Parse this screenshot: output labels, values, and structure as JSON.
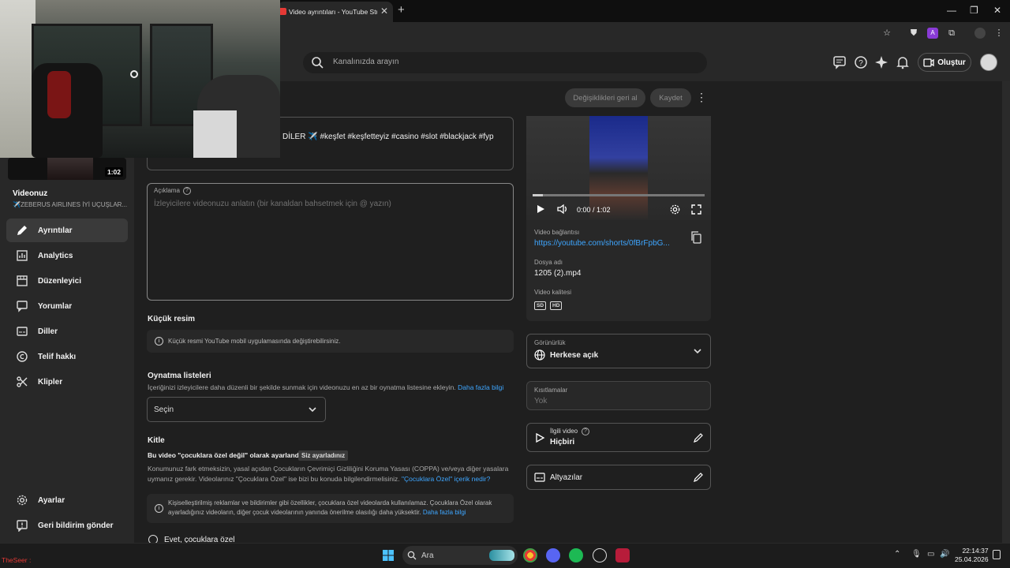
{
  "browser": {
    "tab_title": "Video ayrıntıları - YouTube Studio",
    "new_tab_icon": "plus-icon"
  },
  "topbar": {
    "search_placeholder": "Kanalınızda arayın",
    "create_label": "Oluştur"
  },
  "sidebar": {
    "thumb_duration": "1:02",
    "video_heading": "Videonuz",
    "video_subtitle": "✈️ZEBERUS AIRLINES İYİ UÇUŞLAR...",
    "items": [
      {
        "label": "Ayrıntılar",
        "icon": "pencil-icon",
        "active": true
      },
      {
        "label": "Analytics",
        "icon": "bar-chart-icon"
      },
      {
        "label": "Düzenleyici",
        "icon": "film-editor-icon"
      },
      {
        "label": "Yorumlar",
        "icon": "comment-icon"
      },
      {
        "label": "Diller",
        "icon": "subtitles-icon"
      },
      {
        "label": "Telif hakkı",
        "icon": "copyright-icon"
      },
      {
        "label": "Klipler",
        "icon": "scissors-icon"
      }
    ],
    "bottom_items": [
      {
        "label": "Ayarlar",
        "icon": "gear-icon"
      },
      {
        "label": "Geri bildirim gönder",
        "icon": "feedback-icon"
      }
    ]
  },
  "actions": {
    "revert_label": "Değişiklikleri geri al",
    "save_label": "Kaydet"
  },
  "form": {
    "title_value": "DİLER ✈️ #keşfet #keşfetteyiz #casino #slot #blackjack #fyp",
    "description_label": "Açıklama",
    "description_placeholder": "İzleyicilere videonuzu anlatın (bir kanaldan bahsetmek için @ yazın)",
    "thumbnail_title": "Küçük resim",
    "thumbnail_info": "Küçük resmi YouTube mobil uygulamasında değiştirebilirsiniz.",
    "playlists_title": "Oynatma listeleri",
    "playlists_desc": "İçeriğinizi izleyicilere daha düzenli bir şekilde sunmak için videonuzu en az bir oynatma listesine ekleyin.",
    "playlists_link": "Daha fazla bilgi",
    "playlist_select_value": "Seçin",
    "audience_title": "Kitle",
    "audience_status": "Bu video \"çocuklara özel değil\" olarak ayarlandı",
    "audience_badge": "Siz ayarladınız",
    "audience_desc_1": "Konumunuz fark etmeksizin, yasal açıdan Çocukların Çevrimiçi Gizliliğini Koruma Yasası (COPPA) ve/veya diğer yasalara",
    "audience_desc_2": "uymanız gerekir. Videolarınız \"Çocuklara Özel\" ise bizi bu konuda bilgilendirmelisiniz.",
    "audience_link": "\"Çocuklara Özel\" içerik nedir?",
    "audience_info_1": "Kişiselleştirilmiş reklamlar ve bildirimler gibi özellikler, çocuklara özel videolarda kullanılamaz. Çocuklara Özel olarak",
    "audience_info_2": "ayarladığınız videoların, diğer çocuk videolarının yanında önerilme olasılığı daha yüksektir.",
    "audience_info_link": "Daha fazla bilgi",
    "radio_yes_label": "Evet, çocuklara özel"
  },
  "video_panel": {
    "time": "0:00 / 1:02",
    "progress_fraction": 0.06,
    "link_label": "Video bağlantısı",
    "link_value": "https://youtube.com/shorts/0fBrFpbG...",
    "file_label": "Dosya adı",
    "file_value": "1205 (2).mp4",
    "quality_label": "Video kalitesi",
    "quality_badges": [
      "SD",
      "HD"
    ]
  },
  "right": {
    "visibility_label": "Görünürlük",
    "visibility_value": "Herkese açık",
    "restrictions_label": "Kısıtlamalar",
    "restrictions_value": "Yok",
    "related_label": "İlgili video",
    "related_value": "Hiçbiri",
    "subtitles_label": "Altyazılar"
  },
  "taskbar": {
    "search_placeholder": "Ara",
    "time": "22:14:37",
    "date": "25.04.2026",
    "tray_user": "TheSeer :"
  }
}
